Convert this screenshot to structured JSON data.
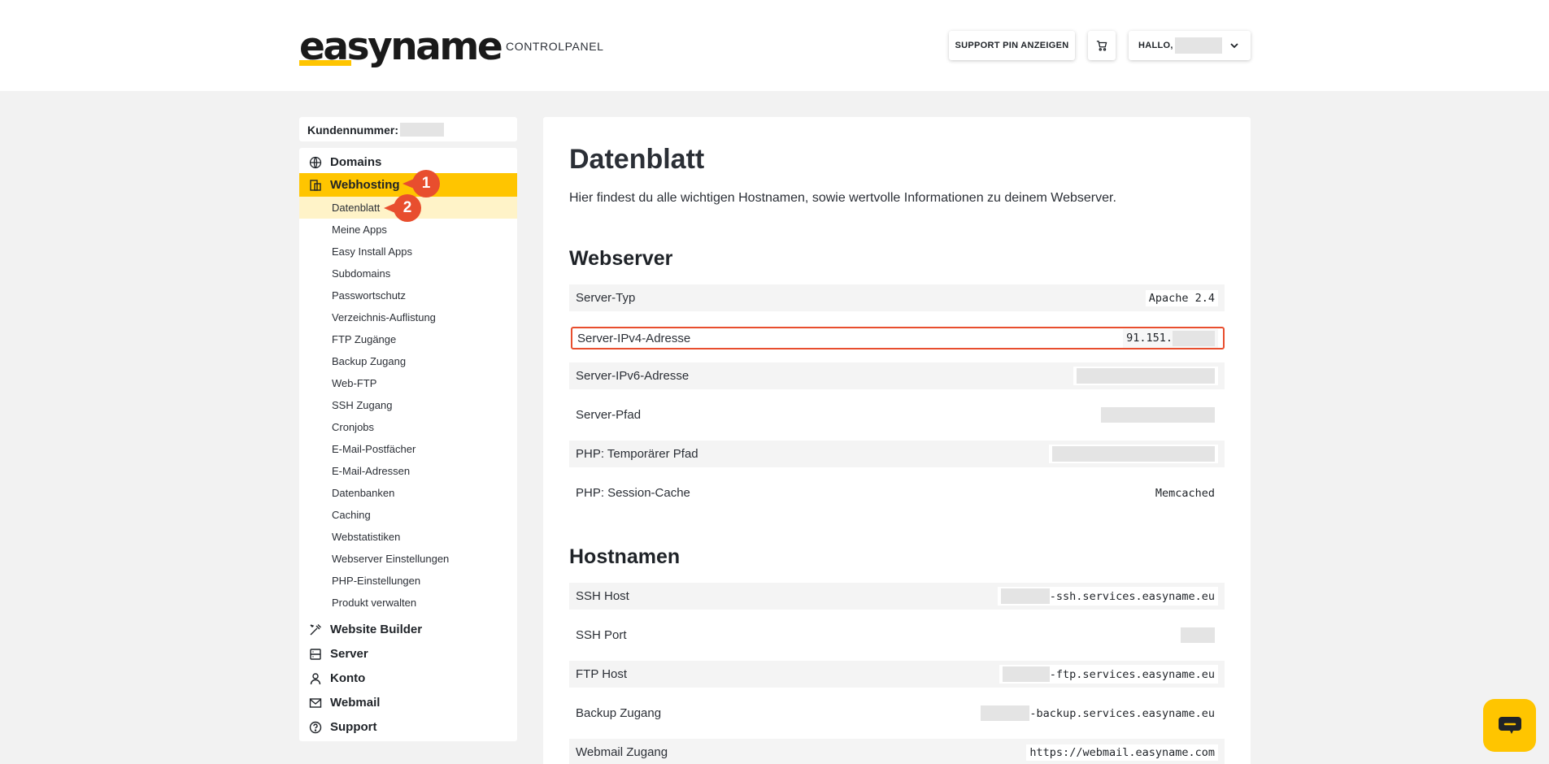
{
  "header": {
    "logo_text": "easyname",
    "subtitle": "CONTROLPANEL",
    "support_button": "SUPPORT PIN ANZEIGEN",
    "cart_icon": "cart-icon",
    "greeting": "HALLO,",
    "brand_color": "#ffc500"
  },
  "sidebar": {
    "customer_label": "Kundennummer:",
    "main_items": [
      {
        "label": "Domains",
        "icon": "globe-icon"
      },
      {
        "label": "Webhosting",
        "icon": "hosting-icon",
        "active": true
      },
      {
        "label": "Website Builder",
        "icon": "builder-icon"
      },
      {
        "label": "Server",
        "icon": "server-icon"
      },
      {
        "label": "Konto",
        "icon": "user-icon"
      },
      {
        "label": "Webmail",
        "icon": "mail-icon"
      },
      {
        "label": "Support",
        "icon": "help-icon"
      }
    ],
    "sub_items": [
      "Datenblatt",
      "Meine Apps",
      "Easy Install Apps",
      "Subdomains",
      "Passwortschutz",
      "Verzeichnis-Auflistung",
      "FTP Zugänge",
      "Backup Zugang",
      "Web-FTP",
      "SSH Zugang",
      "Cronjobs",
      "E-Mail-Postfächer",
      "E-Mail-Adressen",
      "Datenbanken",
      "Caching",
      "Webstatistiken",
      "Webserver Einstellungen",
      "PHP-Einstellungen",
      "Produkt verwalten"
    ],
    "badges": [
      "1",
      "2"
    ]
  },
  "main": {
    "title": "Datenblatt",
    "intro": "Hier findest du alle wichtigen Hostnamen, sowie wertvolle Informationen zu deinem Webserver.",
    "webserver": {
      "title": "Webserver",
      "rows": [
        {
          "label": "Server-Typ",
          "value": "Apache 2.4"
        },
        {
          "label": "Server-IPv4-Adresse",
          "value": "91.151."
        },
        {
          "label": "Server-IPv6-Adresse",
          "value": ""
        },
        {
          "label": "Server-Pfad",
          "value": ""
        },
        {
          "label": "PHP: Temporärer Pfad",
          "value": ""
        },
        {
          "label": "PHP: Session-Cache",
          "value": "Memcached"
        }
      ]
    },
    "hostnamen": {
      "title": "Hostnamen",
      "rows": [
        {
          "label": "SSH Host",
          "value": "-ssh.services.easyname.eu"
        },
        {
          "label": "SSH Port",
          "value": ""
        },
        {
          "label": "FTP Host",
          "value": "-ftp.services.easyname.eu"
        },
        {
          "label": "Backup Zugang",
          "value": "-backup.services.easyname.eu"
        },
        {
          "label": "Webmail Zugang",
          "value": "https://webmail.easyname.com"
        }
      ]
    }
  },
  "chat": {
    "icon": "chat-icon"
  }
}
